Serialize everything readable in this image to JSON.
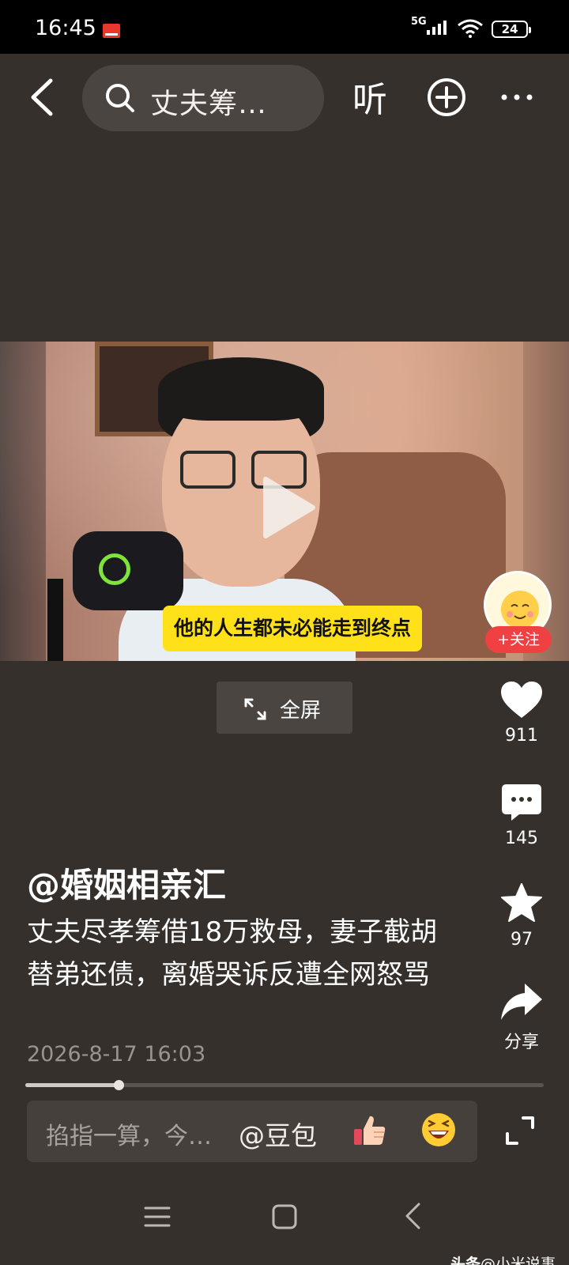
{
  "status_bar": {
    "time": "16:45",
    "network": "5G",
    "battery": "24"
  },
  "top_nav": {
    "search_text": "丈夫筹…",
    "listen_label": "听"
  },
  "video": {
    "subtitle": "他的人生都未必能走到终点"
  },
  "follow_label": "+关注",
  "fullscreen_label": "全屏",
  "actions": {
    "likes": "911",
    "comments": "145",
    "favorites": "97",
    "share_label": "分享"
  },
  "post": {
    "author": "@婚姻相亲汇",
    "description": "丈夫尽孝筹借18万救母，妻子截胡替弟还债，离婚哭诉反遭全网怒骂",
    "date": "2026-8-17 16:03"
  },
  "playback_progress": 0.18,
  "comment_bar": {
    "placeholder": "掐指一算，今…",
    "mention": "@豆包"
  },
  "watermark": {
    "brand": "头条",
    "handle": "@小米说事"
  },
  "colors": {
    "background": "#35302c",
    "follow_red": "#f04142",
    "subtitle_yellow": "#ffe11a"
  },
  "icons": [
    "back-arrow-icon",
    "search-icon",
    "add-circle-icon",
    "more-dots-icon",
    "play-icon",
    "expand-arrows-icon",
    "heart-icon",
    "comment-bubble-icon",
    "star-icon",
    "share-arrow-icon",
    "thumbs-up-emoji",
    "laughing-emoji",
    "fullscreen-corners-icon",
    "menu-icon",
    "home-square-icon",
    "back-chevron-icon"
  ]
}
